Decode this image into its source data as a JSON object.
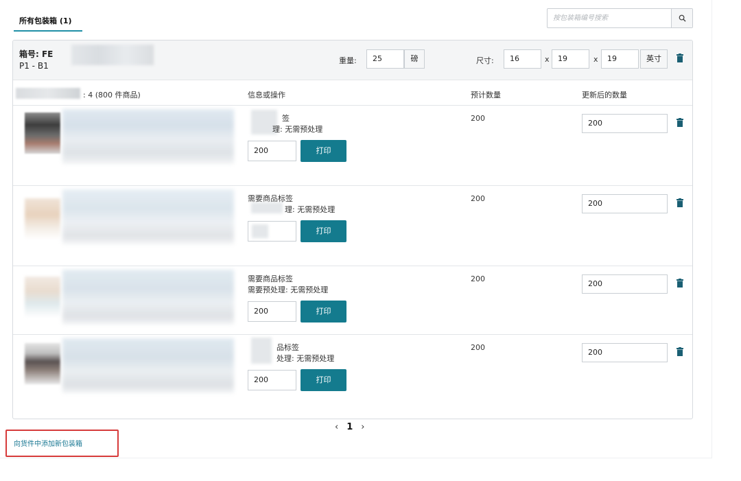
{
  "tabs": [
    {
      "label": "所有包装箱 (1)"
    }
  ],
  "search": {
    "placeholder": "按包装箱编号搜索",
    "icon": "search-icon"
  },
  "box": {
    "label": "箱号: FE",
    "sub": "P1 - B1",
    "weight_label": "重量:",
    "weight_value": "25",
    "weight_unit": "磅",
    "size_label": "尺寸:",
    "dims": [
      "16",
      "19",
      "19"
    ],
    "dim_sep": "x",
    "size_unit": "英寸"
  },
  "table": {
    "col_count": ": 4 (800 件商品)",
    "columns": [
      "信息或操作",
      "预计数量",
      "更新后的数量"
    ],
    "print_label": "打印",
    "rows": [
      {
        "info1": "签",
        "info2": "理: 无需预处理",
        "print_qty": "200",
        "expected": "200",
        "updated": "200"
      },
      {
        "info1": "需要商品标签",
        "info2": "理: 无需预处理",
        "print_qty": "",
        "expected": "200",
        "updated": "200"
      },
      {
        "info1": "需要商品标签",
        "info2": "需要预处理: 无需预处理",
        "print_qty": "200",
        "expected": "200",
        "updated": "200"
      },
      {
        "info1": "品标签",
        "info2": "处理: 无需预处理",
        "print_qty": "200",
        "expected": "200",
        "updated": "200"
      }
    ]
  },
  "pagination": {
    "prev": "‹",
    "current": "1",
    "next": "›"
  },
  "add_box_link": "向货件中添加新包装箱",
  "colors": {
    "accent": "#147b8e",
    "tab_underline": "#1f8fa6",
    "highlight": "#d63a3a"
  }
}
